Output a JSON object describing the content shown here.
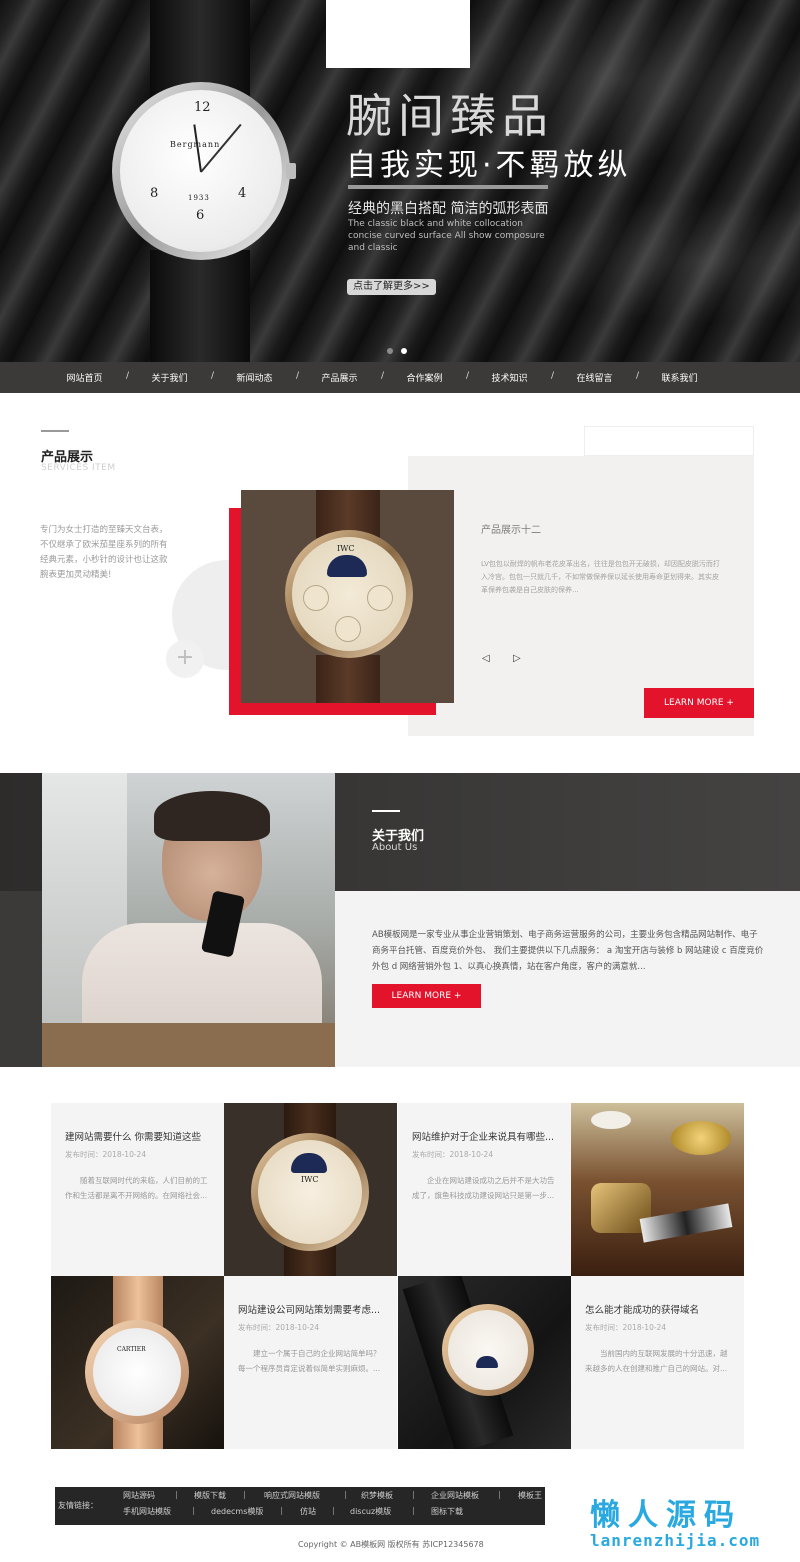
{
  "hero": {
    "title": "腕间臻品",
    "subtitle": "自我实现·不羁放纵",
    "desc_cn": "经典的黑白搭配 简洁的弧形表面",
    "desc_en": "The classic black and white collocation concise curved surface All show composure and classic",
    "button": "点击了解更多>>",
    "dial_brand": "Bergmann",
    "dial_year": "1933",
    "dial_numbers": [
      "12",
      "8",
      "4",
      "6"
    ],
    "dot_colors": [
      "#8c8c8c",
      "#ffffff"
    ]
  },
  "nav": {
    "items": [
      "网站首页",
      "关于我们",
      "新闻动态",
      "产品展示",
      "合作案例",
      "技术知识",
      "在线留言",
      "联系我们"
    ],
    "separator": "/"
  },
  "products": {
    "heading": "产品展示",
    "heading_en": "SERVICES ITEM",
    "intro": "专门为女士打造的至臻天文台表，不仅继承了欧米茄星座系列的所有经典元素，小秒针的设计也让这款腕表更加灵动精美!",
    "item_title": "产品展示十二",
    "item_desc": "LV包包以耐焊的帆布老花皮革出名，往往是包包开无破损，却因配皮脱污而打入冷宫。包包一只就几千，不如常做保养保以延长使用寿命更划得来。其实皮革保养包袭是自己皮肤的保养...",
    "image_brand": "IWC",
    "prev_arrow": "◁",
    "next_arrow": "▷",
    "plus": "+",
    "learn_more": "LEARN MORE +",
    "accent": "#e3132c"
  },
  "about": {
    "heading": "关于我们",
    "heading_en": "About Us",
    "text": "AB模板网是一家专业从事企业营销策划、电子商务运营服务的公司，主要业务包含精品网站制作、电子商务平台托管、百度竞价外包、 我们主要提供以下几点服务： a 淘宝开店与装修 b 网站建设 c 百度竞价外包 d 网络营销外包 1、以真心换真情，站在客户角度，客户的满意就...",
    "learn_more": "LEARN MORE +"
  },
  "news": [
    {
      "title": "建网站需要什么 你需要知道这些",
      "date": "发布时间：2018-10-24",
      "desc": "随着互联网时代的来临，人们目前的工作和生活都是离不开网络的。在网络社会..."
    },
    {
      "title": "网站维护对于企业来说具有哪些...",
      "date": "发布时间：2018-10-24",
      "desc": "企业在网站建设成功之后并不是大功告成了，旗鱼科技成功建设网站只是第一步..."
    },
    {
      "title": "网站建设公司网站策划需要考虑...",
      "date": "发布时间：2018-10-24",
      "desc": "建立一个属于自己的企业网站简单吗？ 每一个程序员肯定说着似简单实则麻烦。..."
    },
    {
      "title": "怎么能才能成功的获得域名",
      "date": "发布时间：2018-10-24",
      "desc": "当前国内的互联网发展的十分迅速，越来越多的人在创建和推广自己的网站。对..."
    }
  ],
  "news_images": {
    "iwc_brand": "IWC",
    "cartier_brand": "CARTIER"
  },
  "footer": {
    "links_label": "友情链接：",
    "links_row1": [
      "网站源码",
      "模版下载",
      "响应式网站模版",
      "织梦模板",
      "企业网站模板",
      "模板王"
    ],
    "links_row2": [
      "手机网站模版",
      "dedecms模版",
      "仿站",
      "discuz模版",
      "图标下载"
    ],
    "separator": "|",
    "copyright": "Copyright © AB模板网 版权所有   苏ICP12345678"
  },
  "watermark": {
    "brand_cn": "懒人源码",
    "brand_en": "lanrenzhijia.com",
    "color": "#29a9e0"
  }
}
